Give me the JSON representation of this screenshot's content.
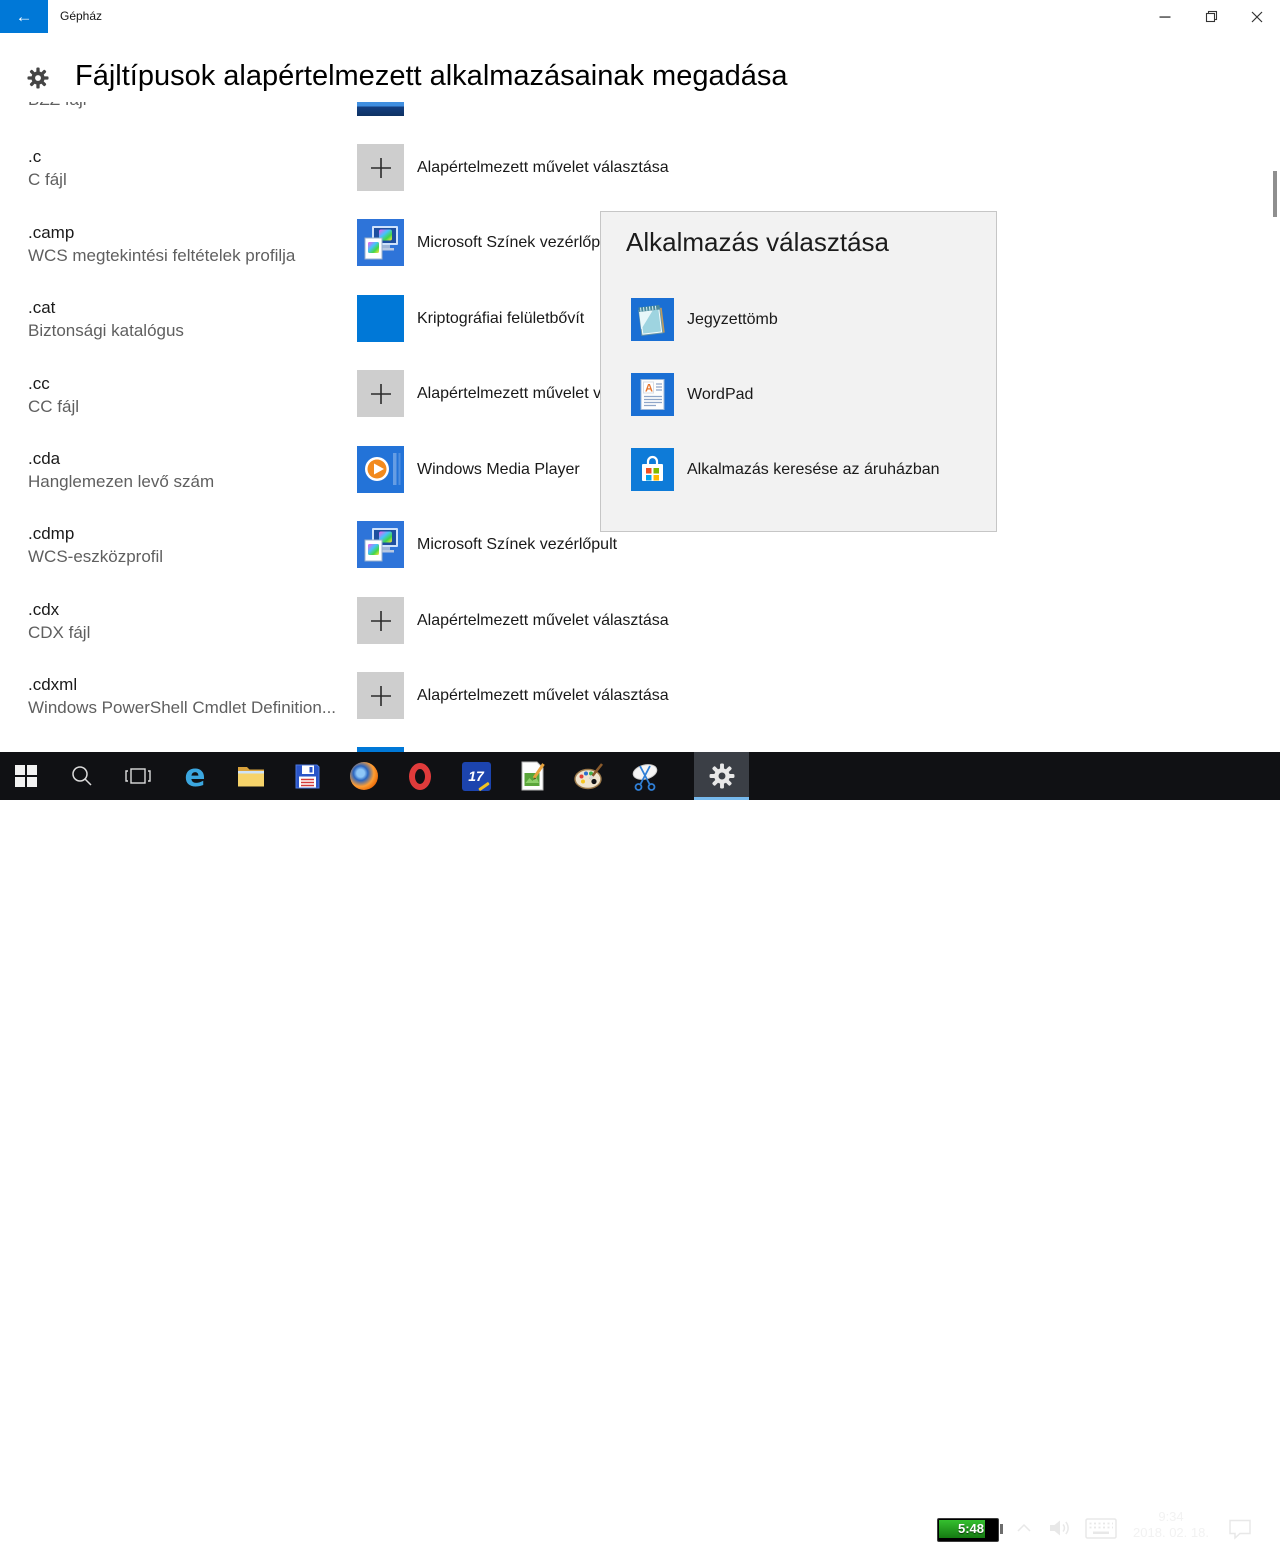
{
  "titlebar": {
    "title": "Gépház",
    "back_glyph": "←"
  },
  "header": {
    "title": "Fájltípusok alapértelmezett alkalmazásainak megadása"
  },
  "file_types": [
    {
      "ext": "",
      "desc": "BZZ fájl"
    },
    {
      "ext": ".c",
      "desc": "C fájl"
    },
    {
      "ext": ".camp",
      "desc": "WCS megtekintési feltételek profilja"
    },
    {
      "ext": ".cat",
      "desc": "Biztonsági katalógus"
    },
    {
      "ext": ".cc",
      "desc": "CC fájl"
    },
    {
      "ext": ".cda",
      "desc": "Hanglemezen levő szám"
    },
    {
      "ext": ".cdmp",
      "desc": "WCS-eszközprofil"
    },
    {
      "ext": ".cdx",
      "desc": "CDX fájl"
    },
    {
      "ext": ".cdxml",
      "desc": "Windows PowerShell Cmdlet Definition..."
    }
  ],
  "app_rows": [
    {
      "icon": "clipped-app-icon",
      "label": ""
    },
    {
      "icon": "plus",
      "label": "Alapértelmezett művelet választása"
    },
    {
      "icon": "ms-colors",
      "label": "Microsoft Színek vezérlőpult"
    },
    {
      "icon": "blue-square",
      "label": "Kriptográfiai felületbővít"
    },
    {
      "icon": "plus",
      "label": "Alapértelmezett művelet választása"
    },
    {
      "icon": "wmp",
      "label": "Windows Media Player"
    },
    {
      "icon": "ms-colors",
      "label": "Microsoft Színek vezérlőpult"
    },
    {
      "icon": "plus",
      "label": "Alapértelmezett művelet választása"
    },
    {
      "icon": "plus",
      "label": "Alapértelmezett művelet választása"
    },
    {
      "icon": "clipped-app-icon",
      "label": ""
    }
  ],
  "popup": {
    "title": "Alkalmazás választása",
    "items": [
      {
        "icon": "notepad",
        "label": "Jegyzettömb"
      },
      {
        "icon": "wordpad",
        "label": "WordPad"
      },
      {
        "icon": "store",
        "label": "Alkalmazás keresése az áruházban"
      }
    ]
  },
  "taskbar": {
    "calendar_day": "17"
  },
  "tray": {
    "battery_time": "5:48",
    "clock_time": "9:34",
    "clock_date": "2018. 02. 18."
  },
  "colors": {
    "accent": "#0078d7",
    "popup_bg": "#f2f2f2",
    "taskbar_bg": "#101114",
    "battery_green": "#1f9e1f"
  }
}
